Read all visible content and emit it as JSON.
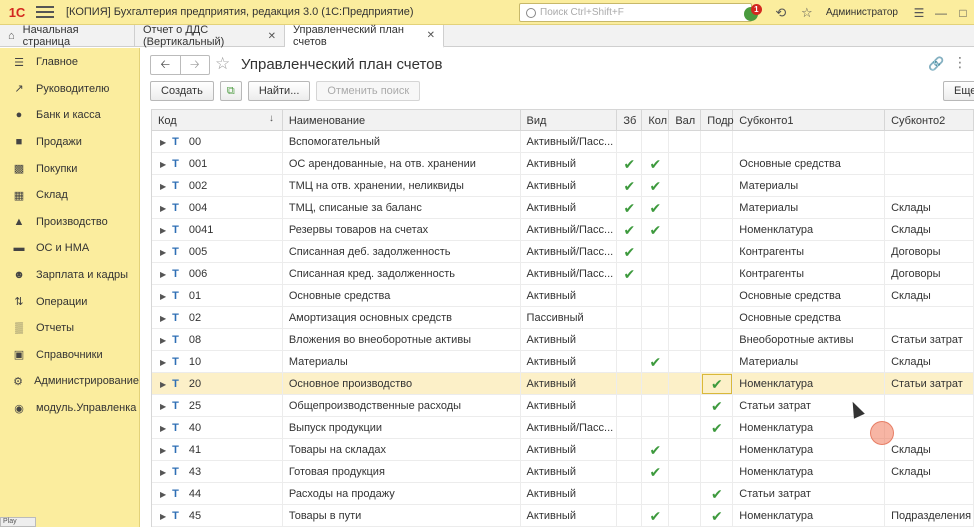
{
  "titlebar": {
    "logo": "1С",
    "title": "[КОПИЯ] Бухгалтерия предприятия, редакция 3.0  (1С:Предприятие)",
    "search_placeholder": "Поиск Ctrl+Shift+F",
    "notifications_count": "1",
    "user": "Администратор"
  },
  "tabs": {
    "home": "Начальная страница",
    "items": [
      {
        "label": "Отчет о ДДС (Вертикальный)"
      },
      {
        "label": "Управленческий план счетов"
      }
    ]
  },
  "sidebar": {
    "items": [
      {
        "label": "Главное",
        "icon": "menu-icon"
      },
      {
        "label": "Руководителю",
        "icon": "chart-line-icon"
      },
      {
        "label": "Банк и касса",
        "icon": "coins-icon"
      },
      {
        "label": "Продажи",
        "icon": "cart-out-icon"
      },
      {
        "label": "Покупки",
        "icon": "cart-in-icon"
      },
      {
        "label": "Склад",
        "icon": "warehouse-icon"
      },
      {
        "label": "Производство",
        "icon": "factory-icon"
      },
      {
        "label": "ОС и НМА",
        "icon": "truck-icon"
      },
      {
        "label": "Зарплата и кадры",
        "icon": "person-icon"
      },
      {
        "label": "Операции",
        "icon": "operations-icon"
      },
      {
        "label": "Отчеты",
        "icon": "bar-chart-icon"
      },
      {
        "label": "Справочники",
        "icon": "book-icon"
      },
      {
        "label": "Администрирование",
        "icon": "gear-icon"
      },
      {
        "label": "модуль.Управленка",
        "icon": "module-icon"
      }
    ]
  },
  "form": {
    "title": "Управленческий план счетов",
    "toolbar": {
      "create": "Создать",
      "find": "Найти...",
      "cancel_search": "Отменить поиск",
      "more": "Еще"
    }
  },
  "table": {
    "columns": {
      "code": "Код",
      "name": "Наименование",
      "vid": "Вид",
      "zb": "Зб",
      "kol": "Кол",
      "val": "Вал",
      "podr": "Подр",
      "sub1": "Субконто1",
      "sub2": "Субконто2"
    },
    "rows": [
      {
        "code": "00",
        "name": "Вспомогательный",
        "vid": "Активный/Пасс...",
        "zb": false,
        "kol": false,
        "val": false,
        "podr": false,
        "sub1": "",
        "sub2": ""
      },
      {
        "code": "001",
        "name": "ОС арендованные, на отв. хранении",
        "vid": "Активный",
        "zb": true,
        "kol": true,
        "val": false,
        "podr": false,
        "sub1": "Основные средства",
        "sub2": ""
      },
      {
        "code": "002",
        "name": "ТМЦ на отв. хранении, неликвиды",
        "vid": "Активный",
        "zb": true,
        "kol": true,
        "val": false,
        "podr": false,
        "sub1": "Материалы",
        "sub2": ""
      },
      {
        "code": "004",
        "name": "ТМЦ, списаные за баланс",
        "vid": "Активный",
        "zb": true,
        "kol": true,
        "val": false,
        "podr": false,
        "sub1": "Материалы",
        "sub2": "Склады"
      },
      {
        "code": "0041",
        "name": "Резервы товаров на счетах",
        "vid": "Активный/Пасс...",
        "zb": true,
        "kol": true,
        "val": false,
        "podr": false,
        "sub1": "Номенклатура",
        "sub2": "Склады"
      },
      {
        "code": "005",
        "name": "Списанная деб. задолженность",
        "vid": "Активный/Пасс...",
        "zb": true,
        "kol": false,
        "val": false,
        "podr": false,
        "sub1": "Контрагенты",
        "sub2": "Договоры"
      },
      {
        "code": "006",
        "name": "Списанная кред. задолженность",
        "vid": "Активный/Пасс...",
        "zb": true,
        "kol": false,
        "val": false,
        "podr": false,
        "sub1": "Контрагенты",
        "sub2": "Договоры"
      },
      {
        "code": "01",
        "name": "Основные средства",
        "vid": "Активный",
        "zb": false,
        "kol": false,
        "val": false,
        "podr": false,
        "sub1": "Основные средства",
        "sub2": "Склады"
      },
      {
        "code": "02",
        "name": "Амортизация основных средств",
        "vid": "Пассивный",
        "zb": false,
        "kol": false,
        "val": false,
        "podr": false,
        "sub1": "Основные средства",
        "sub2": ""
      },
      {
        "code": "08",
        "name": "Вложения во внеоборотные активы",
        "vid": "Активный",
        "zb": false,
        "kol": false,
        "val": false,
        "podr": false,
        "sub1": "Внеоборотные активы",
        "sub2": "Статьи затрат"
      },
      {
        "code": "10",
        "name": "Материалы",
        "vid": "Активный",
        "zb": false,
        "kol": true,
        "val": false,
        "podr": false,
        "sub1": "Материалы",
        "sub2": "Склады"
      },
      {
        "code": "20",
        "name": "Основное производство",
        "vid": "Активный",
        "zb": false,
        "kol": false,
        "val": false,
        "podr": true,
        "sub1": "Номенклатура",
        "sub2": "Статьи затрат",
        "selected": true
      },
      {
        "code": "25",
        "name": "Общепроизводственные расходы",
        "vid": "Активный",
        "zb": false,
        "kol": false,
        "val": false,
        "podr": true,
        "sub1": "Статьи затрат",
        "sub2": ""
      },
      {
        "code": "40",
        "name": "Выпуск продукции",
        "vid": "Активный/Пасс...",
        "zb": false,
        "kol": false,
        "val": false,
        "podr": true,
        "sub1": "Номенклатура",
        "sub2": ""
      },
      {
        "code": "41",
        "name": "Товары на складах",
        "vid": "Активный",
        "zb": false,
        "kol": true,
        "val": false,
        "podr": false,
        "sub1": "Номенклатура",
        "sub2": "Склады"
      },
      {
        "code": "43",
        "name": "Готовая продукция",
        "vid": "Активный",
        "zb": false,
        "kol": true,
        "val": false,
        "podr": false,
        "sub1": "Номенклатура",
        "sub2": "Склады"
      },
      {
        "code": "44",
        "name": "Расходы на продажу",
        "vid": "Активный",
        "zb": false,
        "kol": false,
        "val": false,
        "podr": true,
        "sub1": "Статьи затрат",
        "sub2": ""
      },
      {
        "code": "45",
        "name": "Товары в пути",
        "vid": "Активный",
        "zb": false,
        "kol": true,
        "val": false,
        "podr": true,
        "sub1": "Номенклатура",
        "sub2": "Подразделения"
      }
    ]
  },
  "status_label": "Play"
}
